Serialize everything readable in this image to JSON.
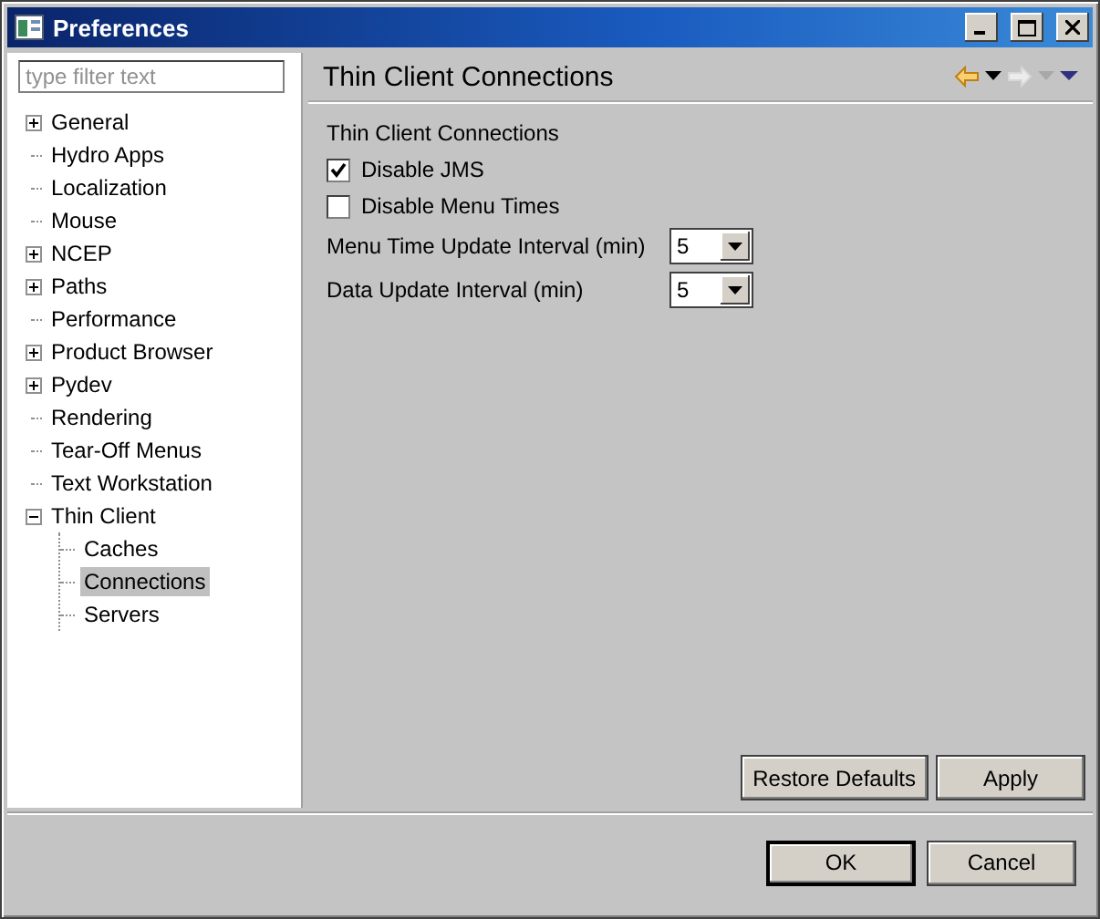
{
  "window": {
    "title": "Preferences"
  },
  "filter": {
    "placeholder": "type filter text"
  },
  "tree": [
    {
      "label": "General",
      "expandable": true,
      "expanded": false,
      "selected": false
    },
    {
      "label": "Hydro Apps",
      "expandable": false,
      "selected": false
    },
    {
      "label": "Localization",
      "expandable": false,
      "selected": false
    },
    {
      "label": "Mouse",
      "expandable": false,
      "selected": false
    },
    {
      "label": "NCEP",
      "expandable": true,
      "expanded": false,
      "selected": false
    },
    {
      "label": "Paths",
      "expandable": true,
      "expanded": false,
      "selected": false
    },
    {
      "label": "Performance",
      "expandable": false,
      "selected": false
    },
    {
      "label": "Product Browser",
      "expandable": true,
      "expanded": false,
      "selected": false
    },
    {
      "label": "Pydev",
      "expandable": true,
      "expanded": false,
      "selected": false
    },
    {
      "label": "Rendering",
      "expandable": false,
      "selected": false
    },
    {
      "label": "Tear-Off Menus",
      "expandable": false,
      "selected": false
    },
    {
      "label": "Text Workstation",
      "expandable": false,
      "selected": false
    },
    {
      "label": "Thin Client",
      "expandable": true,
      "expanded": true,
      "selected": false,
      "children": [
        {
          "label": "Caches",
          "expandable": false,
          "selected": false
        },
        {
          "label": "Connections",
          "expandable": false,
          "selected": true
        },
        {
          "label": "Servers",
          "expandable": false,
          "selected": false
        }
      ]
    }
  ],
  "page": {
    "title": "Thin Client Connections",
    "back_enabled": true,
    "forward_enabled": false,
    "section": "Thin Client Connections",
    "checkboxes": [
      {
        "label": "Disable JMS",
        "checked": true
      },
      {
        "label": "Disable Menu Times",
        "checked": false
      }
    ],
    "dropdowns": [
      {
        "label": "Menu Time Update Interval (min)",
        "value": "5"
      },
      {
        "label": "Data Update Interval (min)",
        "value": "5"
      }
    ],
    "buttons": [
      "Restore Defaults",
      "Apply"
    ]
  },
  "dialog_buttons": [
    {
      "label": "OK",
      "default": true
    },
    {
      "label": "Cancel",
      "default": false
    }
  ]
}
